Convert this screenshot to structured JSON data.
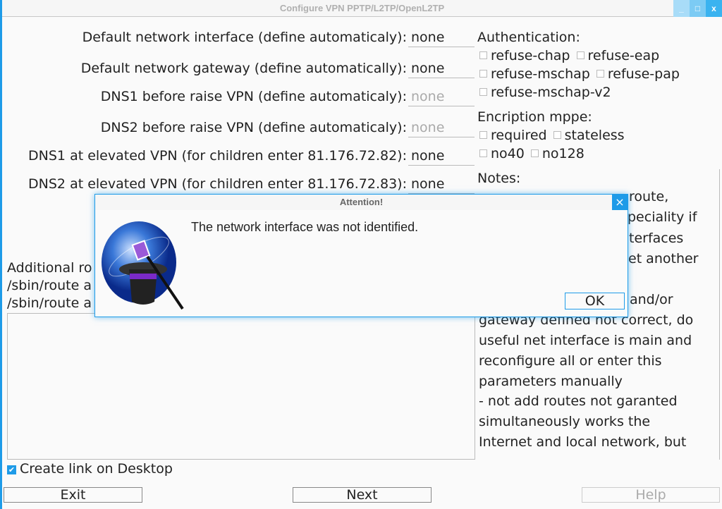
{
  "window": {
    "title": "Configure VPN PPTP/L2TP/OpenL2TP",
    "minimize": "_",
    "maximize": "□",
    "close": "x"
  },
  "fields": [
    {
      "label": "Default network interface (define automaticaly):",
      "value": "none",
      "placeholder": false
    },
    {
      "label": "Default network gateway (define automatically):",
      "value": "none",
      "placeholder": false
    },
    {
      "label": "DNS1 before raise VPN (define automaticaly):",
      "value": "none",
      "placeholder": true
    },
    {
      "label": "DNS2 before raise VPN (define automaticaly):",
      "value": "none",
      "placeholder": true
    },
    {
      "label": "DNS1 at elevated VPN (for children enter 81.176.72.82):",
      "value": "none",
      "placeholder": false
    },
    {
      "label": "DNS2 at elevated VPN (for children enter 81.176.72.83):",
      "value": "none",
      "placeholder": false
    }
  ],
  "auth": {
    "title": "Authentication:",
    "options": [
      "refuse-chap",
      "refuse-eap",
      "refuse-mschap",
      "refuse-pap",
      "refuse-mschap-v2"
    ]
  },
  "mppe": {
    "title": "Encription mppe:",
    "options": [
      "required",
      "stateless",
      "no40",
      "no128"
    ]
  },
  "notes": {
    "title": "Notes:",
    "partial": [
      "route,",
      "peciality if",
      "terfaces",
      "et another",
      "and/or"
    ],
    "lines": [
      "gateway defined not correct, do",
      "useful net interface is main and",
      "reconfigure all or enter this",
      "parameters manually",
      "- not add routes not garanted",
      "simultaneously works the",
      "Internet and local network, but"
    ]
  },
  "routes": {
    "lines": [
      "Additional ro",
      "/sbin/route a",
      "/sbin/route a"
    ],
    "value": ""
  },
  "desktop_link": {
    "label": "Create link on Desktop",
    "checked": true
  },
  "buttons": {
    "exit": "Exit",
    "next": "Next",
    "help": "Help"
  },
  "dialog": {
    "title": "Attention!",
    "message": "The network interface was not identified.",
    "ok": "OK",
    "close": "×",
    "icon": "magic-hat-globe-icon"
  },
  "colors": {
    "accent": "#1e9be8"
  }
}
